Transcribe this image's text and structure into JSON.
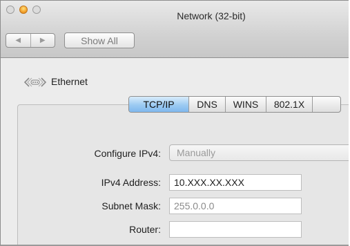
{
  "window": {
    "title": "Network (32-bit)",
    "nav_back": "◀",
    "nav_forward": "▶",
    "show_all_label": "Show All"
  },
  "service": {
    "name": "Ethernet",
    "icon": "ethernet-icon"
  },
  "tabs": [
    {
      "label": "TCP/IP",
      "active": true
    },
    {
      "label": "DNS",
      "active": false
    },
    {
      "label": "WINS",
      "active": false
    },
    {
      "label": "802.1X",
      "active": false
    }
  ],
  "form": {
    "configure_ipv4_label": "Configure IPv4:",
    "configure_ipv4_value": "Manually",
    "ipv4_address_label": "IPv4 Address:",
    "ipv4_address_value": "10.XXX.XX.XXX",
    "subnet_mask_label": "Subnet Mask:",
    "subnet_mask_value": "255.0.0.0",
    "router_label": "Router:",
    "router_value": ""
  },
  "colors": {
    "active_tab": "#9ccaf2",
    "minimize_button": "#f3a12c"
  }
}
